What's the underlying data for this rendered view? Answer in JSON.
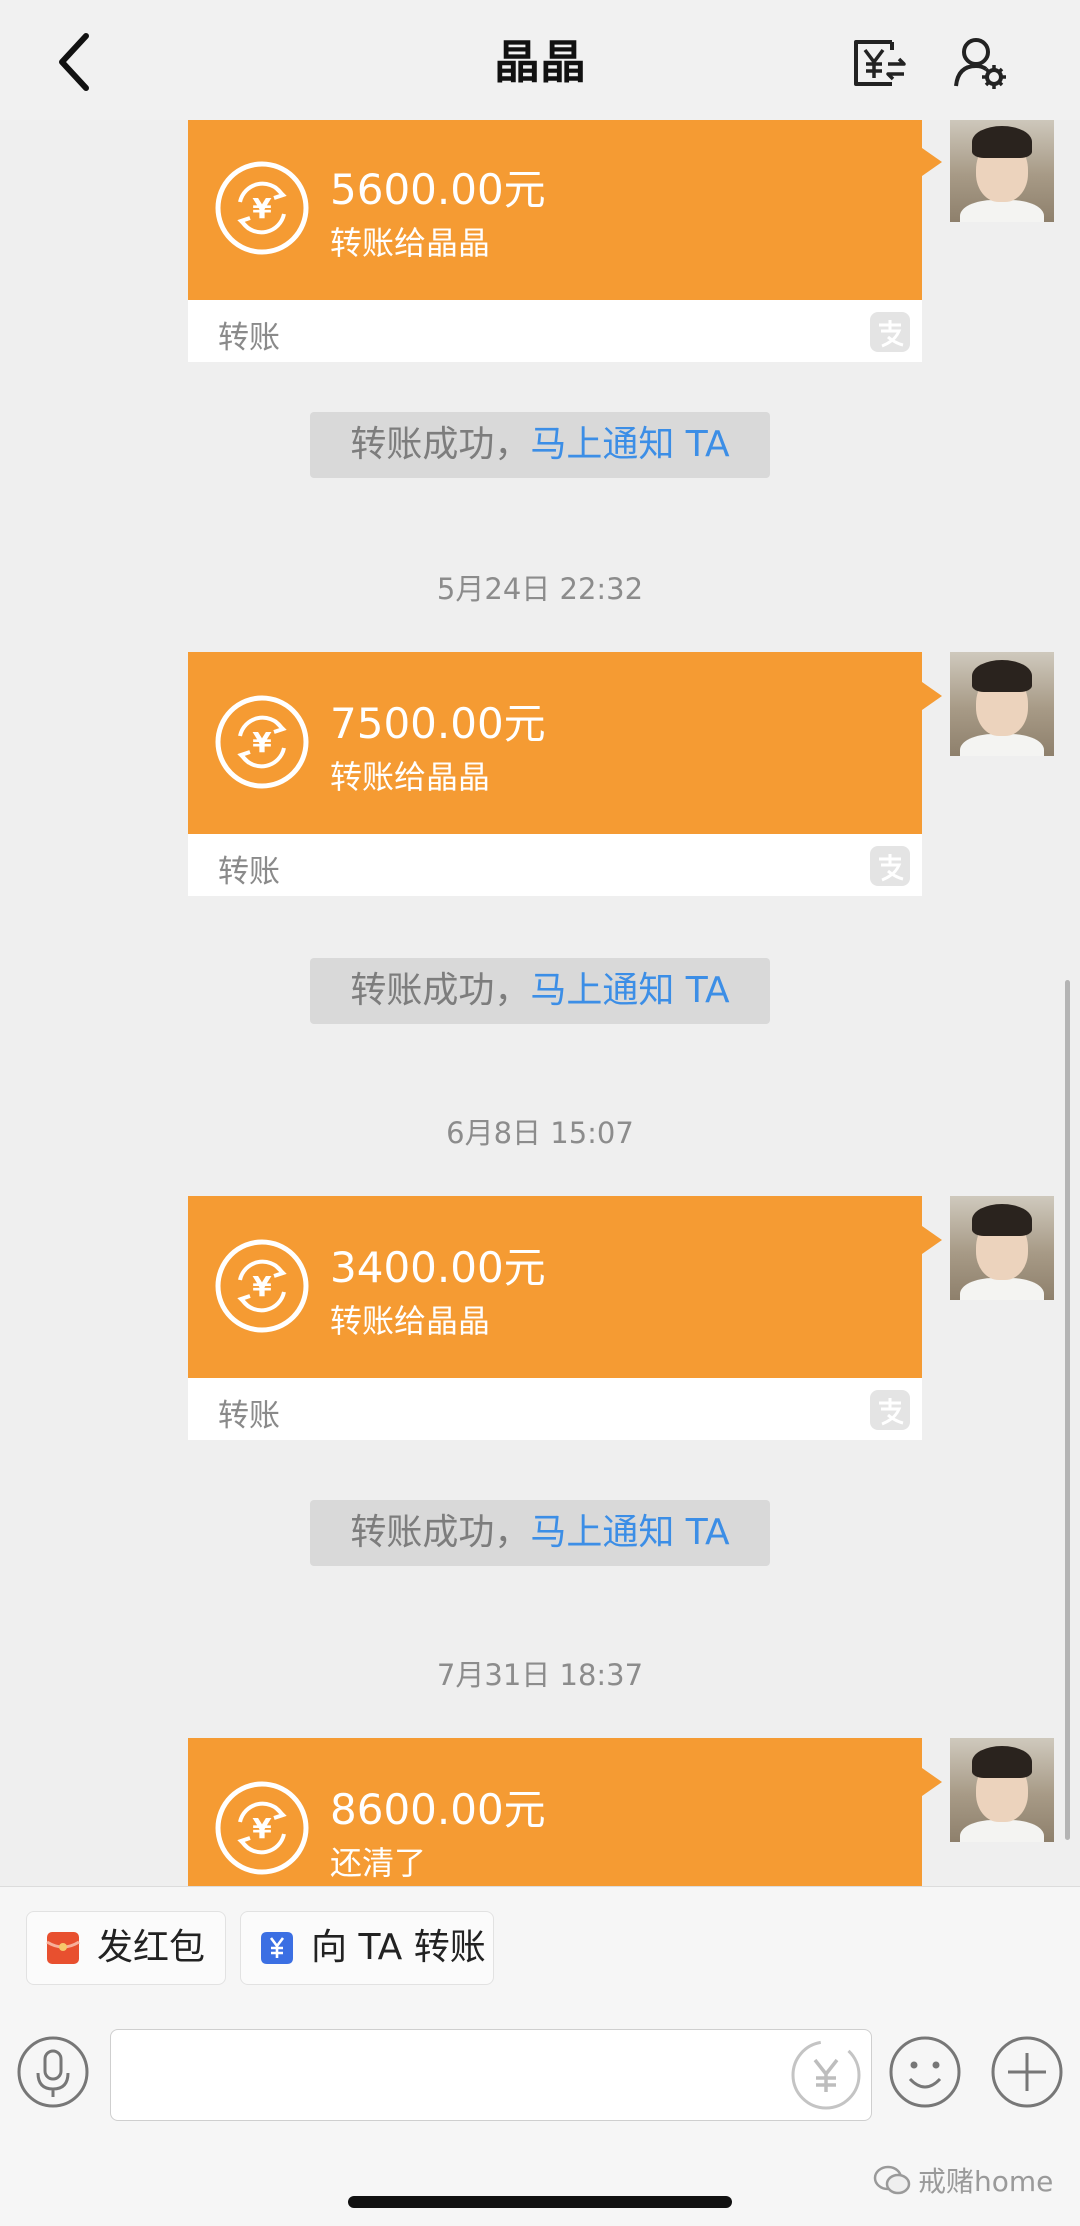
{
  "header": {
    "title": "晶晶"
  },
  "messages": [
    {
      "amount": "5600.00元",
      "note": "转账给晶晶",
      "type_label": "转账"
    },
    {
      "amount": "7500.00元",
      "note": "转账给晶晶",
      "type_label": "转账"
    },
    {
      "amount": "3400.00元",
      "note": "转账给晶晶",
      "type_label": "转账"
    },
    {
      "amount": "8600.00元",
      "note": "还清了",
      "type_label": ""
    }
  ],
  "notices": [
    {
      "text": "转账成功，",
      "link": "马上通知 TA"
    },
    {
      "text": "转账成功，",
      "link": "马上通知 TA"
    },
    {
      "text": "转账成功，",
      "link": "马上通知 TA"
    }
  ],
  "timestamps": [
    "5月24日 22:32",
    "6月8日 15:07",
    "7月31日 18:37"
  ],
  "quick_actions": {
    "red_packet": "发红包",
    "transfer": "向 TA 转账"
  },
  "watermark": "戒赌home",
  "colors": {
    "transfer_orange": "#f59b33",
    "link_blue": "#3c8ee6",
    "red_packet": "#e8502f",
    "transfer_icon_blue": "#3b6fe3"
  },
  "icons": {
    "back": "chevron-left-icon",
    "header_transfer": "transfer-record-icon",
    "header_profile": "user-settings-icon",
    "coin": "yen-exchange-icon",
    "alipay": "alipay-logo-icon",
    "mic": "microphone-icon",
    "input_yen": "yen-transfer-icon",
    "emoji": "emoji-icon",
    "plus": "plus-icon"
  }
}
